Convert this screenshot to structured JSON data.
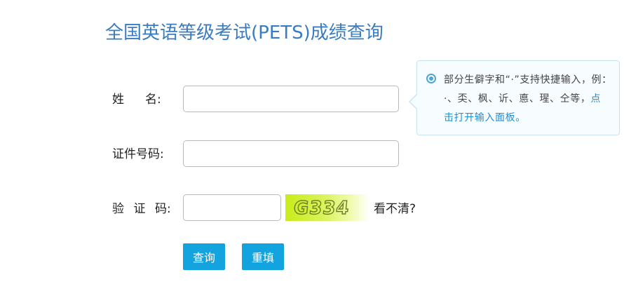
{
  "page": {
    "title": "全国英语等级考试(PETS)成绩查询"
  },
  "form": {
    "name_label_chars": [
      "姓",
      "名"
    ],
    "name_label_colon": ":",
    "id_label": "证件号码:",
    "captcha_label_chars": [
      "验",
      "证",
      "码"
    ],
    "captcha_label_colon": ":",
    "name_value": "",
    "id_value": "",
    "captcha_value": "",
    "captcha_image_text": "G334",
    "refresh_label": "看不清?"
  },
  "buttons": {
    "query_label": "查询",
    "reset_label": "重填"
  },
  "tooltip": {
    "text": "部分生僻字和“·”支持快捷输入，例：·、奀、枫、䜣、悳、瑆、仝等，",
    "link_label": "点击打开输入面板。"
  },
  "colors": {
    "title": "#3a7cc0",
    "button": "#13a3df",
    "tooltip_border": "#c7e3f4",
    "tooltip_background": "#f7fcff",
    "tooltip_link": "#1e8fd6",
    "captcha_green": "#c8ec1a"
  },
  "icons": {
    "tooltip_icon": "radio-info-icon"
  }
}
